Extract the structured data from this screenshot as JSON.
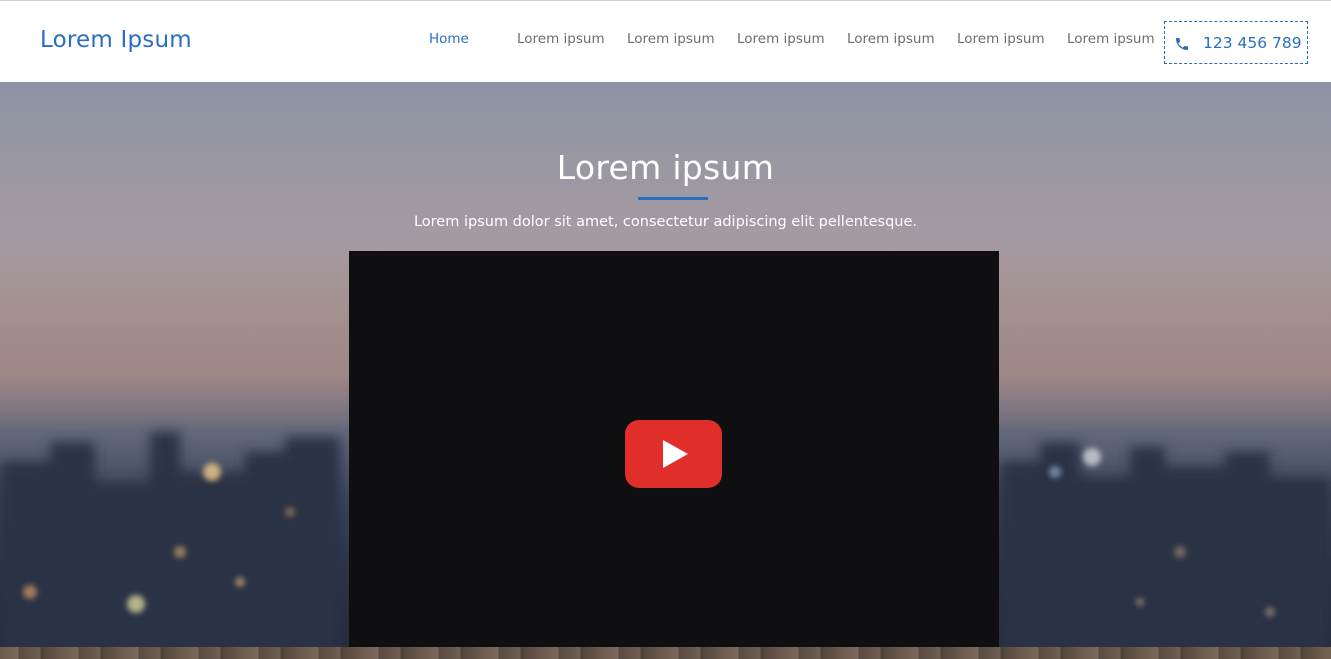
{
  "header": {
    "logo": "Lorem Ipsum",
    "nav": [
      {
        "label": "Home",
        "active": true
      },
      {
        "label": "Lorem ipsum",
        "active": false
      },
      {
        "label": "Lorem ipsum",
        "active": false
      },
      {
        "label": "Lorem ipsum",
        "active": false
      },
      {
        "label": "Lorem ipsum",
        "active": false
      },
      {
        "label": "Lorem ipsum",
        "active": false
      },
      {
        "label": "Lorem ipsum",
        "active": false
      }
    ],
    "phone": {
      "icon": "phone-icon",
      "number": "123 456 789"
    }
  },
  "hero": {
    "title": "Lorem ipsum",
    "subtitle": "Lorem ipsum dolor sit amet, consectetur adipiscing elit pellentesque.",
    "video": {
      "play_icon": "youtube-play-icon"
    }
  },
  "colors": {
    "accent": "#2a6fbf",
    "nav_text": "#6d6d6d",
    "video_bg": "#0f0e10",
    "play_red": "#e02f2a"
  }
}
